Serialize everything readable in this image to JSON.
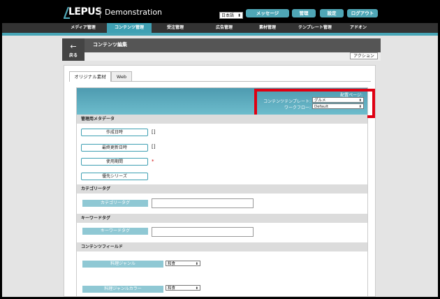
{
  "header": {
    "logo": "LEPUS",
    "site_name": "Demonstration",
    "language": "日本語",
    "buttons": [
      "メッセージ",
      "管理",
      "設定",
      "ログアウト"
    ]
  },
  "nav": {
    "items": [
      "メディア管理",
      "コンテンツ管理",
      "受注管理",
      "広告管理",
      "素材管理",
      "テンプレート管理",
      "アドオン"
    ],
    "active_index": 1
  },
  "page": {
    "back_label": "戻る",
    "title": "コンテンツ編集",
    "action_label": "アクション"
  },
  "tabs": [
    "オリジナル素材",
    "Web"
  ],
  "banner": {
    "placement_label": "配置ページ:",
    "template_label": "コンテンツテンプレート:",
    "template_value": "グルメ",
    "workflow_label": "ワークフロー:",
    "workflow_value": "Default"
  },
  "meta": {
    "heading": "管理用メタデータ",
    "fields": [
      {
        "label": "作成日時",
        "value": "[]"
      },
      {
        "label": "最終更新日時",
        "value": "[]"
      },
      {
        "label": "使用期間",
        "value": "*"
      },
      {
        "label": "優先シリーズ",
        "value": ""
      }
    ]
  },
  "category": {
    "heading": "カテゴリータグ",
    "label": "カテゴリータグ"
  },
  "keyword": {
    "heading": "キーワードタグ",
    "label": "キーワードタグ"
  },
  "content_fields": {
    "heading": "コンテンツフィールド",
    "fields": [
      {
        "label": "料理ジャンル",
        "value": "和食"
      },
      {
        "label": "料理ジャンルカラー",
        "value": "和食"
      }
    ]
  },
  "colors": {
    "accent": "#3fa0b3",
    "highlight": "#e00012"
  }
}
